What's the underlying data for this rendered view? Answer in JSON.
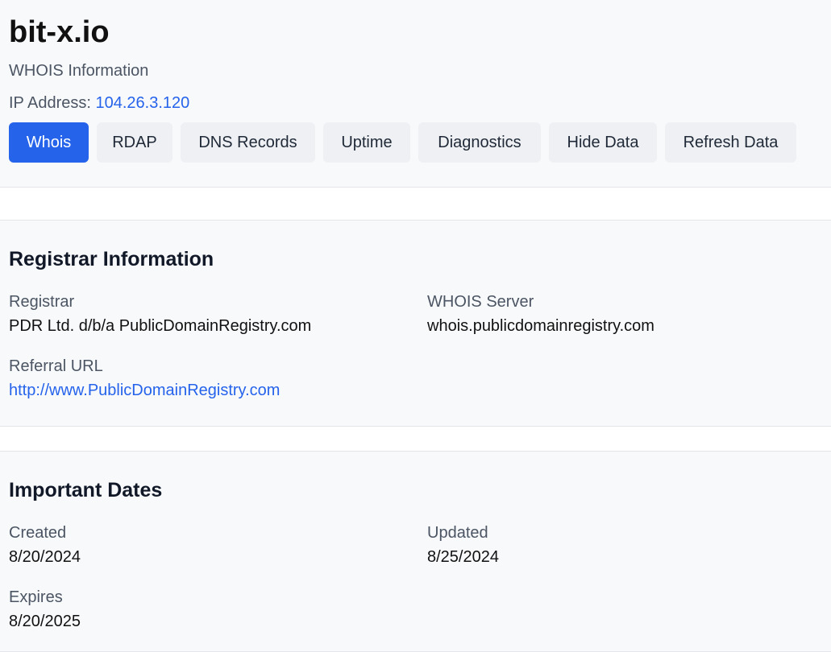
{
  "header": {
    "domain": "bit-x.io",
    "subtitle": "WHOIS Information",
    "ip_label": "IP Address: ",
    "ip_value": "104.26.3.120"
  },
  "tabs": [
    {
      "label": "Whois",
      "active": true
    },
    {
      "label": "RDAP",
      "active": false
    },
    {
      "label": "DNS Records",
      "active": false
    },
    {
      "label": "Uptime",
      "active": false
    },
    {
      "label": "Diagnostics",
      "active": false
    },
    {
      "label": "Hide Data",
      "active": false
    },
    {
      "label": "Refresh Data",
      "active": false
    }
  ],
  "registrar": {
    "title": "Registrar Information",
    "registrar_label": "Registrar",
    "registrar_value": "PDR Ltd. d/b/a PublicDomainRegistry.com",
    "whois_server_label": "WHOIS Server",
    "whois_server_value": "whois.publicdomainregistry.com",
    "referral_label": "Referral URL",
    "referral_value": "http://www.PublicDomainRegistry.com"
  },
  "dates": {
    "title": "Important Dates",
    "created_label": "Created",
    "created_value": "8/20/2024",
    "updated_label": "Updated",
    "updated_value": "8/25/2024",
    "expires_label": "Expires",
    "expires_value": "8/20/2025"
  },
  "colors": {
    "accent": "#2563eb",
    "tab_bg": "#eef0f3",
    "panel_bg": "#f8f9fb"
  }
}
